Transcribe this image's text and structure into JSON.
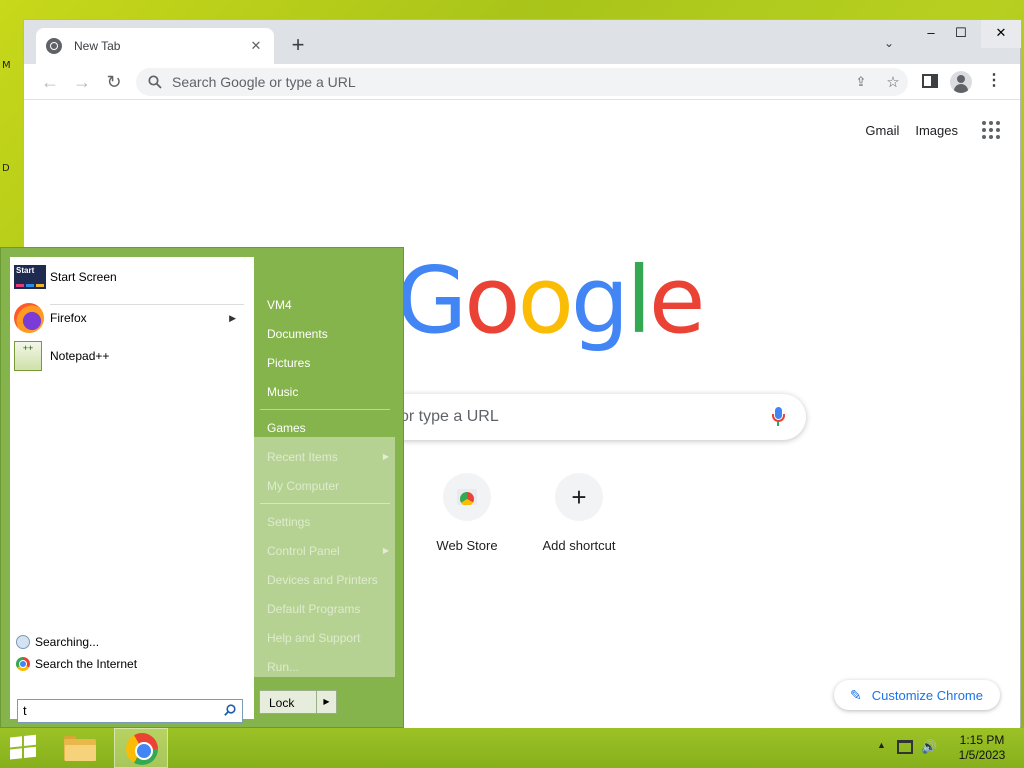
{
  "desktop": {
    "edge_labels": [
      "M",
      "D"
    ]
  },
  "browser": {
    "tab": {
      "title": "New Tab",
      "close": "✕"
    },
    "new_tab": "+",
    "tab_search": "⌄",
    "window": {
      "minimize": "–",
      "maximize": "☐",
      "close": "✕"
    },
    "toolbar": {
      "back": "←",
      "forward": "→",
      "reload": "↻",
      "omnibox_placeholder": "Search Google or type a URL"
    },
    "page": {
      "top_links": [
        "Gmail",
        "Images"
      ],
      "logo_letters": [
        {
          "ch": "G",
          "color": "#4285f4"
        },
        {
          "ch": "o",
          "color": "#ea4335"
        },
        {
          "ch": "o",
          "color": "#fbbc05"
        },
        {
          "ch": "g",
          "color": "#4285f4"
        },
        {
          "ch": "l",
          "color": "#34a853"
        },
        {
          "ch": "e",
          "color": "#ea4335"
        }
      ],
      "search_placeholder": "or type a URL",
      "shortcuts": [
        {
          "label": "Web Store",
          "icon": "web-store-icon"
        },
        {
          "label": "Add shortcut",
          "icon": "plus-icon"
        }
      ],
      "customize_label": "Customize Chrome"
    }
  },
  "start_menu": {
    "pinned": [
      {
        "label": "Start Screen",
        "icon": "start-screen-icon",
        "tile_text": "Start"
      },
      {
        "label": "Firefox",
        "icon": "firefox-icon",
        "has_submenu": true
      },
      {
        "label": "Notepad++",
        "icon": "notepad-plus-plus-icon"
      }
    ],
    "search_results": [
      {
        "label": "Searching...",
        "icon": "search-icon"
      },
      {
        "label": "Search the Internet",
        "icon": "chrome-icon"
      }
    ],
    "search_value": "t",
    "right_column": {
      "top_items": [
        "VM4",
        "Documents",
        "Pictures",
        "Music"
      ],
      "games": "Games",
      "dim_items_a": [
        {
          "label": "Recent Items",
          "arrow": true
        },
        {
          "label": "My Computer",
          "arrow": false
        }
      ],
      "dim_items_b": [
        {
          "label": "Settings",
          "arrow": false
        },
        {
          "label": "Control Panel",
          "arrow": true
        },
        {
          "label": "Devices and Printers",
          "arrow": false
        },
        {
          "label": "Default Programs",
          "arrow": false
        },
        {
          "label": "Help and Support",
          "arrow": false
        },
        {
          "label": "Run...",
          "arrow": false
        }
      ],
      "lock_label": "Lock"
    }
  },
  "taskbar": {
    "time": "1:15 PM",
    "date": "1/5/2023",
    "pinned_icons": [
      "windows-start-icon",
      "file-explorer-icon",
      "chrome-icon"
    ]
  }
}
